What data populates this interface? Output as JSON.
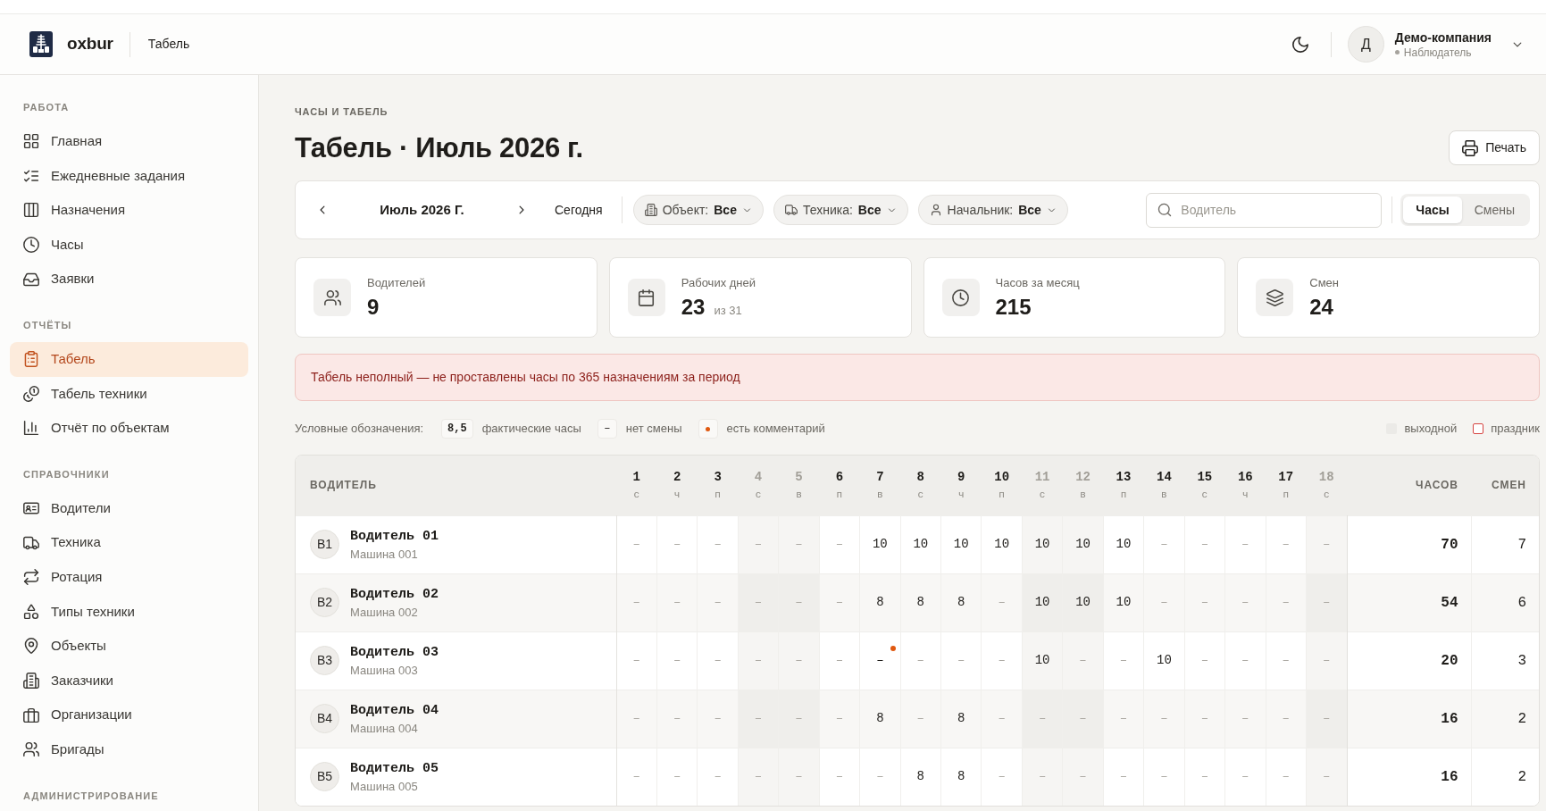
{
  "header": {
    "brand": "oxbur",
    "page_title": "Табель",
    "user": {
      "initial": "Д",
      "company": "Демо-компания",
      "role": "Наблюдатель"
    }
  },
  "sidebar": {
    "sections": [
      {
        "title": "РАБОТА",
        "items": [
          {
            "label": "Главная",
            "selected": false
          },
          {
            "label": "Ежедневные задания",
            "selected": false
          },
          {
            "label": "Назначения",
            "selected": false
          },
          {
            "label": "Часы",
            "selected": false
          },
          {
            "label": "Заявки",
            "selected": false
          }
        ]
      },
      {
        "title": "ОТЧЁТЫ",
        "items": [
          {
            "label": "Табель",
            "selected": true
          },
          {
            "label": "Табель техники",
            "selected": false
          },
          {
            "label": "Отчёт по объектам",
            "selected": false
          }
        ]
      },
      {
        "title": "СПРАВОЧНИКИ",
        "items": [
          {
            "label": "Водители",
            "selected": false
          },
          {
            "label": "Техника",
            "selected": false
          },
          {
            "label": "Ротация",
            "selected": false
          },
          {
            "label": "Типы техники",
            "selected": false
          },
          {
            "label": "Объекты",
            "selected": false
          },
          {
            "label": "Заказчики",
            "selected": false
          },
          {
            "label": "Организации",
            "selected": false
          },
          {
            "label": "Бригады",
            "selected": false
          }
        ]
      },
      {
        "title": "АДМИНИСТРИРОВАНИЕ"
      }
    ]
  },
  "page": {
    "breadcrumb": "ЧАСЫ И ТАБЕЛЬ",
    "title": "Табель · Июль 2026 г.",
    "print_button": "Печать"
  },
  "toolbar": {
    "period": "Июль 2026 Г.",
    "today_button": "Сегодня",
    "filters": [
      {
        "label": "Объект:",
        "value": "Все"
      },
      {
        "label": "Техника:",
        "value": "Все"
      },
      {
        "label": "Начальник:",
        "value": "Все"
      }
    ],
    "search": {
      "placeholder": "Водитель"
    },
    "view_tabs": [
      {
        "label": "Часы",
        "selected": true
      },
      {
        "label": "Смены",
        "selected": false
      }
    ]
  },
  "stats": [
    {
      "label": "Водителей",
      "value": "9"
    },
    {
      "label": "Рабочих дней",
      "value": "23",
      "suffix": "из 31"
    },
    {
      "label": "Часов за месяц",
      "value": "215"
    },
    {
      "label": "Смен",
      "value": "24"
    }
  ],
  "alert": {
    "text": "Табель неполный — не проставлены часы по 365 назначениям за период"
  },
  "legend": {
    "title": "Условные обозначения:",
    "items": [
      {
        "kind": "hours",
        "sample": "8,5",
        "label": "фактические часы"
      },
      {
        "kind": "none",
        "sample": "–",
        "label": "нет смены"
      },
      {
        "kind": "comment",
        "label": "есть комментарий"
      }
    ],
    "day_types": [
      {
        "kind": "weekend",
        "label": "выходной"
      },
      {
        "kind": "holiday",
        "label": "праздник"
      }
    ]
  },
  "table": {
    "columns": {
      "driver": "ВОДИТЕЛЬ",
      "hours": "ЧАСОВ",
      "shifts": "СМЕН"
    },
    "days": [
      {
        "day": "1",
        "weekday": "с",
        "weekend": false
      },
      {
        "day": "2",
        "weekday": "ч",
        "weekend": false
      },
      {
        "day": "3",
        "weekday": "п",
        "weekend": false
      },
      {
        "day": "4",
        "weekday": "с",
        "weekend": true
      },
      {
        "day": "5",
        "weekday": "в",
        "weekend": true
      },
      {
        "day": "6",
        "weekday": "п",
        "weekend": false
      },
      {
        "day": "7",
        "weekday": "в",
        "weekend": false
      },
      {
        "day": "8",
        "weekday": "с",
        "weekend": false
      },
      {
        "day": "9",
        "weekday": "ч",
        "weekend": false
      },
      {
        "day": "10",
        "weekday": "п",
        "weekend": false
      },
      {
        "day": "11",
        "weekday": "с",
        "weekend": true
      },
      {
        "day": "12",
        "weekday": "в",
        "weekend": true
      },
      {
        "day": "13",
        "weekday": "п",
        "weekend": false
      },
      {
        "day": "14",
        "weekday": "в",
        "weekend": false
      },
      {
        "day": "15",
        "weekday": "с",
        "weekend": false
      },
      {
        "day": "16",
        "weekday": "ч",
        "weekend": false
      },
      {
        "day": "17",
        "weekday": "п",
        "weekend": false
      },
      {
        "day": "18",
        "weekday": "с",
        "weekend": true
      }
    ],
    "rows": [
      {
        "initials": "В1",
        "name": "Водитель 01",
        "vehicle": "Машина 001",
        "hours": "70",
        "shifts": "7",
        "cells": [
          {
            "value": "–",
            "kind": "none",
            "comment": false
          },
          {
            "value": "–",
            "kind": "none",
            "comment": false
          },
          {
            "value": "–",
            "kind": "none",
            "comment": false
          },
          {
            "value": "–",
            "kind": "none",
            "comment": false
          },
          {
            "value": "–",
            "kind": "none",
            "comment": false
          },
          {
            "value": "–",
            "kind": "none",
            "comment": false
          },
          {
            "value": "10",
            "kind": "hours",
            "comment": false
          },
          {
            "value": "10",
            "kind": "hours",
            "comment": false
          },
          {
            "value": "10",
            "kind": "hours",
            "comment": false
          },
          {
            "value": "10",
            "kind": "hours",
            "comment": false
          },
          {
            "value": "10",
            "kind": "hours",
            "comment": false
          },
          {
            "value": "10",
            "kind": "hours",
            "comment": false
          },
          {
            "value": "10",
            "kind": "hours",
            "comment": false
          },
          {
            "value": "–",
            "kind": "none",
            "comment": false
          },
          {
            "value": "–",
            "kind": "none",
            "comment": false
          },
          {
            "value": "–",
            "kind": "none",
            "comment": false
          },
          {
            "value": "–",
            "kind": "none",
            "comment": false
          },
          {
            "value": "–",
            "kind": "none",
            "comment": false
          }
        ]
      },
      {
        "initials": "В2",
        "name": "Водитель 02",
        "vehicle": "Машина 002",
        "hours": "54",
        "shifts": "6",
        "cells": [
          {
            "value": "–",
            "kind": "none",
            "comment": false
          },
          {
            "value": "–",
            "kind": "none",
            "comment": false
          },
          {
            "value": "–",
            "kind": "none",
            "comment": false
          },
          {
            "value": "–",
            "kind": "none",
            "comment": false
          },
          {
            "value": "–",
            "kind": "none",
            "comment": false
          },
          {
            "value": "–",
            "kind": "none",
            "comment": false
          },
          {
            "value": "8",
            "kind": "hours",
            "comment": false
          },
          {
            "value": "8",
            "kind": "hours",
            "comment": false
          },
          {
            "value": "8",
            "kind": "hours",
            "comment": false
          },
          {
            "value": "–",
            "kind": "none",
            "comment": false
          },
          {
            "value": "10",
            "kind": "hours",
            "comment": false
          },
          {
            "value": "10",
            "kind": "hours",
            "comment": false
          },
          {
            "value": "10",
            "kind": "hours",
            "comment": false
          },
          {
            "value": "–",
            "kind": "none",
            "comment": false
          },
          {
            "value": "–",
            "kind": "none",
            "comment": false
          },
          {
            "value": "–",
            "kind": "none",
            "comment": false
          },
          {
            "value": "–",
            "kind": "none",
            "comment": false
          },
          {
            "value": "–",
            "kind": "none",
            "comment": false
          }
        ]
      },
      {
        "initials": "В3",
        "name": "Водитель 03",
        "vehicle": "Машина 003",
        "hours": "20",
        "shifts": "3",
        "cells": [
          {
            "value": "–",
            "kind": "none",
            "comment": false
          },
          {
            "value": "–",
            "kind": "none",
            "comment": false
          },
          {
            "value": "–",
            "kind": "none",
            "comment": false
          },
          {
            "value": "–",
            "kind": "none",
            "comment": false
          },
          {
            "value": "–",
            "kind": "none",
            "comment": false
          },
          {
            "value": "–",
            "kind": "none",
            "comment": false
          },
          {
            "value": "–",
            "kind": "none",
            "comment": true
          },
          {
            "value": "–",
            "kind": "none",
            "comment": false
          },
          {
            "value": "–",
            "kind": "none",
            "comment": false
          },
          {
            "value": "–",
            "kind": "none",
            "comment": false
          },
          {
            "value": "10",
            "kind": "hours",
            "comment": false
          },
          {
            "value": "–",
            "kind": "none",
            "comment": false
          },
          {
            "value": "–",
            "kind": "none",
            "comment": false
          },
          {
            "value": "10",
            "kind": "hours",
            "comment": false
          },
          {
            "value": "–",
            "kind": "none",
            "comment": false
          },
          {
            "value": "–",
            "kind": "none",
            "comment": false
          },
          {
            "value": "–",
            "kind": "none",
            "comment": false
          },
          {
            "value": "–",
            "kind": "none",
            "comment": false
          }
        ]
      },
      {
        "initials": "В4",
        "name": "Водитель 04",
        "vehicle": "Машина 004",
        "hours": "16",
        "shifts": "2",
        "cells": [
          {
            "value": "–",
            "kind": "none",
            "comment": false
          },
          {
            "value": "–",
            "kind": "none",
            "comment": false
          },
          {
            "value": "–",
            "kind": "none",
            "comment": false
          },
          {
            "value": "–",
            "kind": "none",
            "comment": false
          },
          {
            "value": "–",
            "kind": "none",
            "comment": false
          },
          {
            "value": "–",
            "kind": "none",
            "comment": false
          },
          {
            "value": "8",
            "kind": "hours",
            "comment": false
          },
          {
            "value": "–",
            "kind": "none",
            "comment": false
          },
          {
            "value": "8",
            "kind": "hours",
            "comment": false
          },
          {
            "value": "–",
            "kind": "none",
            "comment": false
          },
          {
            "value": "–",
            "kind": "none",
            "comment": false
          },
          {
            "value": "–",
            "kind": "none",
            "comment": false
          },
          {
            "value": "–",
            "kind": "none",
            "comment": false
          },
          {
            "value": "–",
            "kind": "none",
            "comment": false
          },
          {
            "value": "–",
            "kind": "none",
            "comment": false
          },
          {
            "value": "–",
            "kind": "none",
            "comment": false
          },
          {
            "value": "–",
            "kind": "none",
            "comment": false
          },
          {
            "value": "–",
            "kind": "none",
            "comment": false
          }
        ]
      },
      {
        "initials": "В5",
        "name": "Водитель 05",
        "vehicle": "Машина 005",
        "hours": "16",
        "shifts": "2",
        "cells": [
          {
            "value": "–",
            "kind": "none",
            "comment": false
          },
          {
            "value": "–",
            "kind": "none",
            "comment": false
          },
          {
            "value": "–",
            "kind": "none",
            "comment": false
          },
          {
            "value": "–",
            "kind": "none",
            "comment": false
          },
          {
            "value": "–",
            "kind": "none",
            "comment": false
          },
          {
            "value": "–",
            "kind": "none",
            "comment": false
          },
          {
            "value": "–",
            "kind": "none",
            "comment": false
          },
          {
            "value": "8",
            "kind": "hours",
            "comment": false
          },
          {
            "value": "8",
            "kind": "hours",
            "comment": false
          },
          {
            "value": "–",
            "kind": "none",
            "comment": false
          },
          {
            "value": "–",
            "kind": "none",
            "comment": false
          },
          {
            "value": "–",
            "kind": "none",
            "comment": false
          },
          {
            "value": "–",
            "kind": "none",
            "comment": false
          },
          {
            "value": "–",
            "kind": "none",
            "comment": false
          },
          {
            "value": "–",
            "kind": "none",
            "comment": false
          },
          {
            "value": "–",
            "kind": "none",
            "comment": false
          },
          {
            "value": "–",
            "kind": "none",
            "comment": false
          },
          {
            "value": "–",
            "kind": "none",
            "comment": false
          }
        ]
      }
    ]
  }
}
